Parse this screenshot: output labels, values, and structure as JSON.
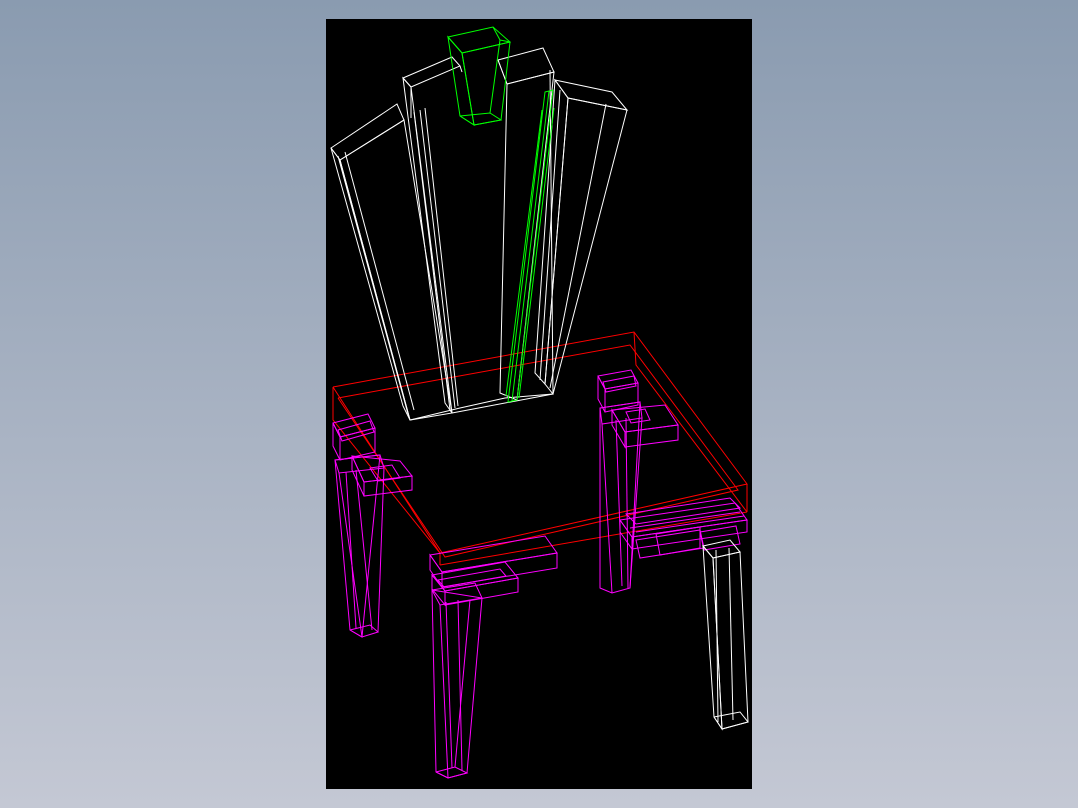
{
  "viewport": {
    "background_color": "#000000",
    "page_gradient": [
      "#8a9bb0",
      "#c4c8d4"
    ]
  },
  "layers": [
    {
      "name": "seat-frame",
      "color": "#ff0000"
    },
    {
      "name": "legs-and-joinery",
      "color": "#ff00ff"
    },
    {
      "name": "back-panels",
      "color": "#ffffff"
    },
    {
      "name": "crest-and-splat",
      "color": "#00ff00"
    },
    {
      "name": "front-right-leg",
      "color": "#ffffff"
    }
  ]
}
